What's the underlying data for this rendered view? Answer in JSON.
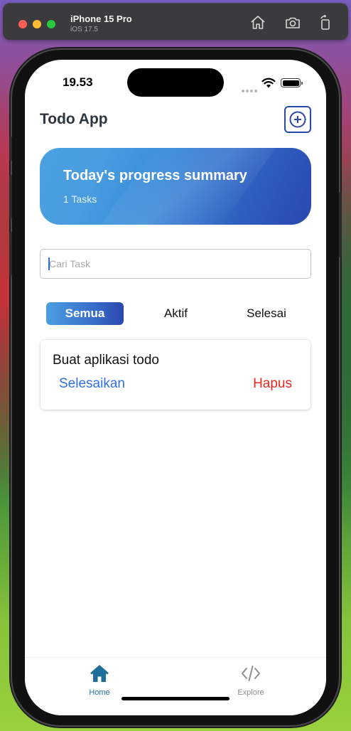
{
  "simulator": {
    "device": "iPhone 15 Pro",
    "os": "iOS 17.5",
    "icons": [
      "home-icon",
      "screenshot-icon",
      "rotate-icon"
    ]
  },
  "status_bar": {
    "time": "19.53"
  },
  "header": {
    "title": "Todo App",
    "add_icon": "plus-circle-icon"
  },
  "progress": {
    "title": "Today's progress summary",
    "count_text": "1 Tasks"
  },
  "search": {
    "placeholder": "Cari Task",
    "value": ""
  },
  "filters": {
    "tabs": [
      {
        "label": "Semua",
        "selected": true
      },
      {
        "label": "Aktif",
        "selected": false
      },
      {
        "label": "Selesai",
        "selected": false
      }
    ]
  },
  "tasks": [
    {
      "title": "Buat aplikasi todo",
      "finish_label": "Selesaikan",
      "delete_label": "Hapus"
    }
  ],
  "tab_bar": {
    "items": [
      {
        "label": "Home",
        "icon": "house-icon",
        "active": true
      },
      {
        "label": "Explore",
        "icon": "code-icon",
        "active": false
      }
    ]
  },
  "colors": {
    "accent": "#2a4aa8",
    "card_gradient_start": "#4aa0e0",
    "card_gradient_end": "#2a48b0",
    "finish": "#2f6fe4",
    "delete": "#e8261e",
    "tab_active": "#1f6e9a"
  }
}
